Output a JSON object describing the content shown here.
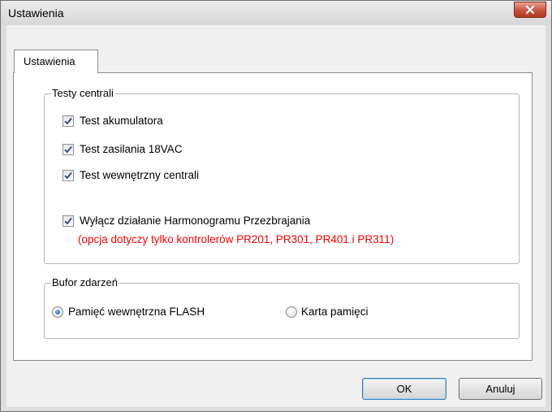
{
  "window": {
    "title": "Ustawienia"
  },
  "tabs": [
    {
      "label": "Ustawienia"
    }
  ],
  "groups": {
    "tests": {
      "title": "Testy centrali",
      "items": [
        {
          "label": "Test akumulatora",
          "checked": true
        },
        {
          "label": "Test zasilania 18VAC",
          "checked": true
        },
        {
          "label": "Test wewnętrzny centrali",
          "checked": true
        },
        {
          "label": "Wyłącz działanie Harmonogramu Przezbrajania",
          "checked": true,
          "note": "(opcja dotyczy tylko kontrolerów PR201, PR301, PR401 i PR311)"
        }
      ]
    },
    "buffer": {
      "title": "Bufor zdarzeń",
      "options": [
        {
          "label": "Pamięć wewnętrzna FLASH",
          "selected": true
        },
        {
          "label": "Karta pamięci",
          "selected": false
        }
      ]
    }
  },
  "buttons": {
    "ok": "OK",
    "cancel": "Anuluj"
  },
  "colors": {
    "note": "#ff0000",
    "close_button": "#c75340",
    "check_mark": "#2a4f9a"
  }
}
